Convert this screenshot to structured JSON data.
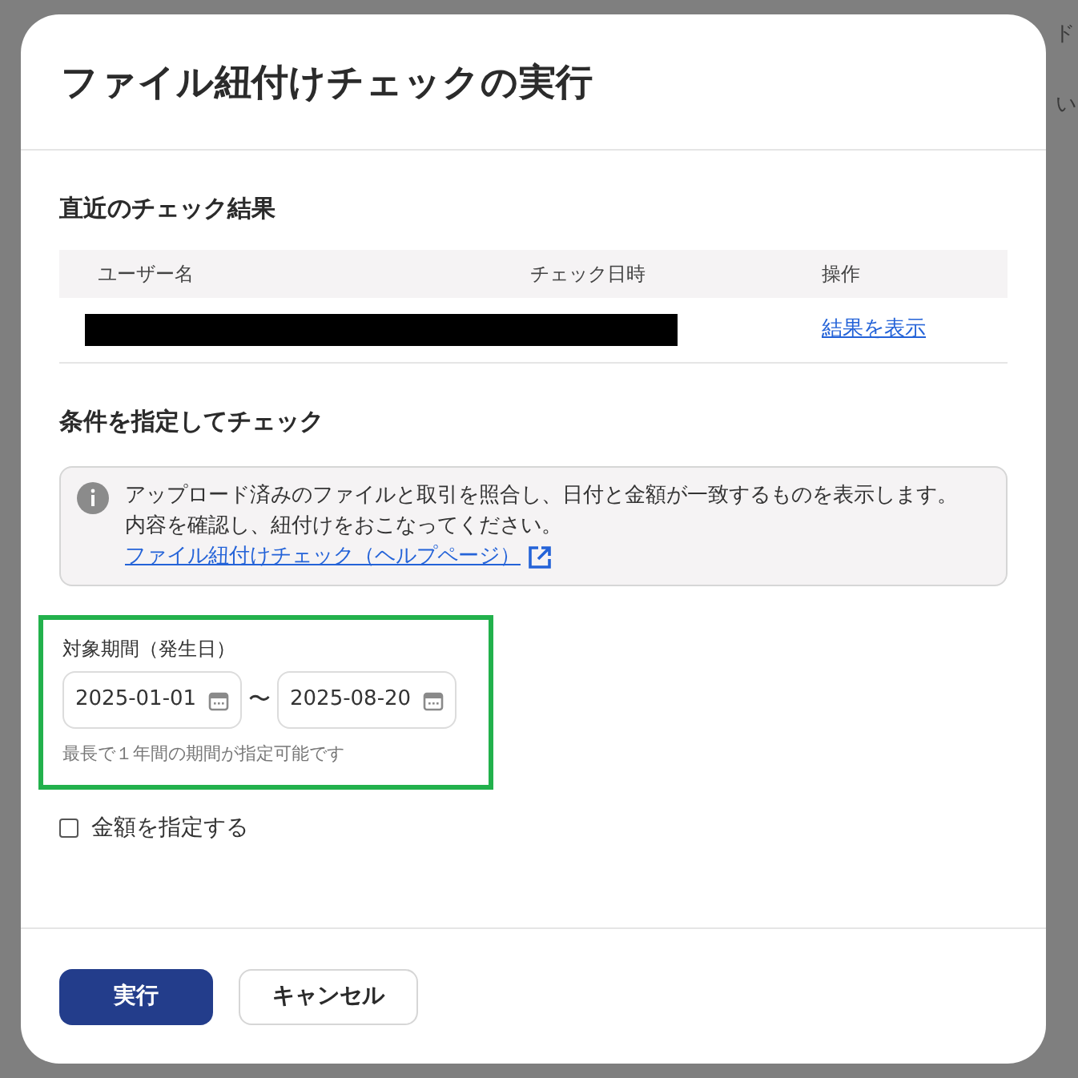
{
  "background_fragments": [
    {
      "text": "ド"
    },
    {
      "text": "い"
    }
  ],
  "dialog": {
    "title": "ファイル紐付けチェックの実行",
    "recent": {
      "heading": "直近のチェック結果",
      "columns": [
        "ユーザー名",
        "チェック日時",
        "操作"
      ],
      "rows": [
        {
          "action": "結果を表示"
        }
      ]
    },
    "conditions": {
      "heading": "条件を指定してチェック",
      "info": {
        "lines": [
          "アップロード済みのファイルと取引を照合し、日付と金額が一致するものを表示します。",
          "内容を確認し、紐付けをおこなってください。"
        ],
        "link": "ファイル紐付けチェック（ヘルプページ）"
      },
      "period": {
        "label": "対象期間（発生日）",
        "from": "2025-01-01",
        "separator": "〜",
        "to": "2025-08-20",
        "hint": "最長で１年間の期間が指定可能です",
        "highlighted": true
      },
      "amount_checkbox": {
        "label": "金額を指定する",
        "checked": false
      }
    },
    "buttons": [
      {
        "label": "実行",
        "kind": "primary"
      },
      {
        "label": "キャンセル",
        "kind": "secondary"
      }
    ]
  }
}
